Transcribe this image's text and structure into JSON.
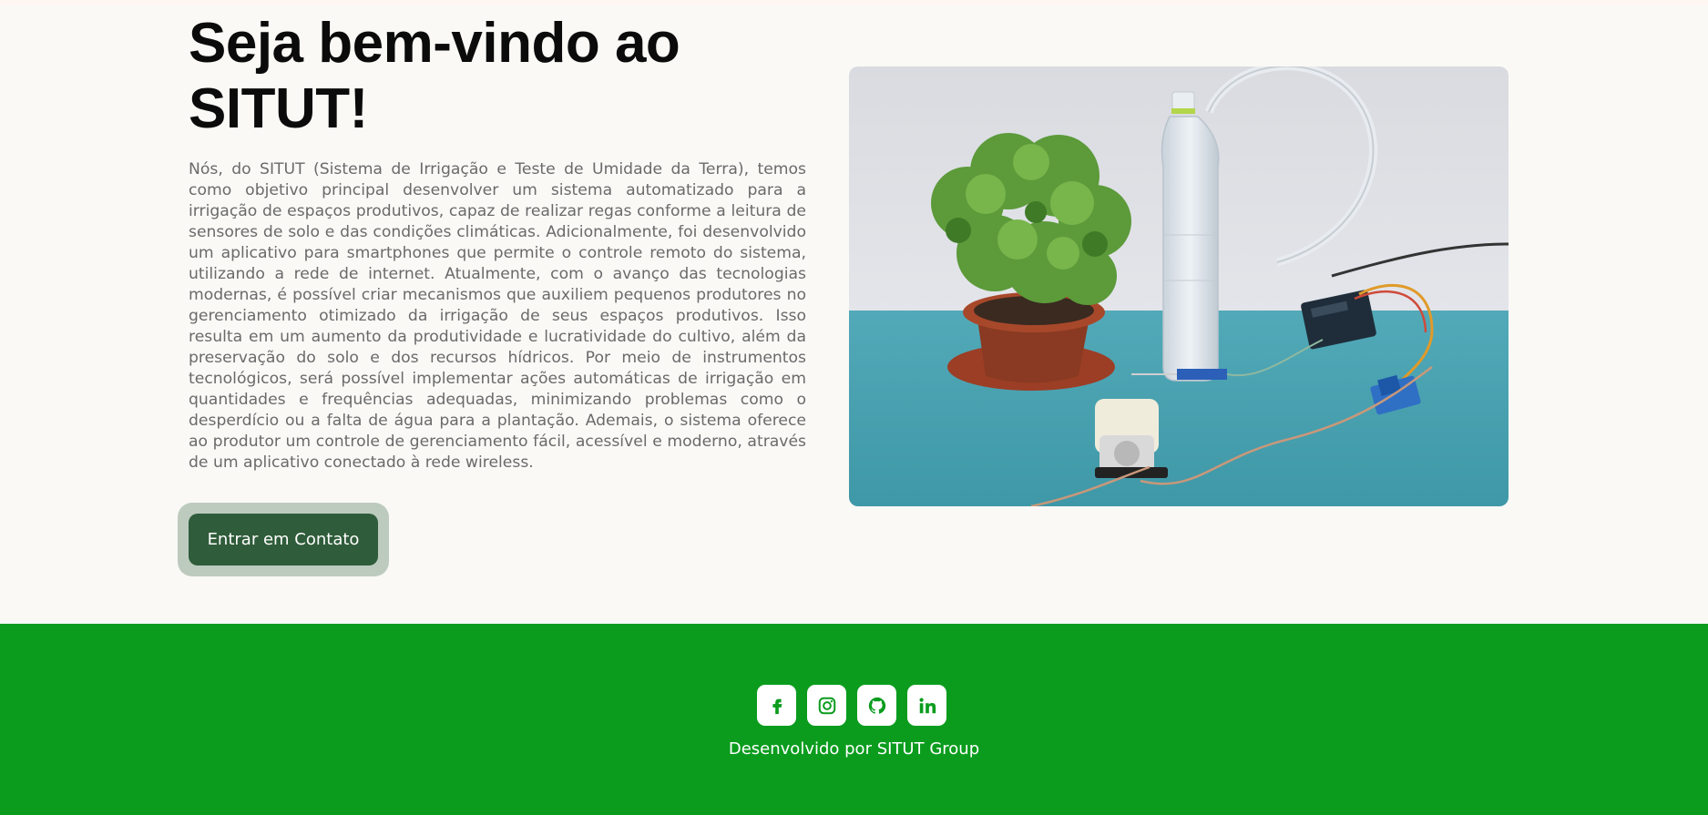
{
  "hero": {
    "title": "Seja bem-vindo ao SITUT!",
    "description": "Nós, do SITUT (Sistema de Irrigação e Teste de Umidade da Terra), temos como objetivo principal desenvolver um sistema automatizado para a irrigação de espaços produtivos, capaz de realizar regas conforme a leitura de sensores de solo e das condições climáticas. Adicionalmente, foi desenvolvido um aplicativo para smartphones que permite o controle remoto do sistema, utilizando a rede de internet. Atualmente, com o avanço das tecnologias modernas, é possível criar mecanismos que auxiliem pequenos produtores no gerenciamento otimizado da irrigação de seus espaços produtivos. Isso resulta em um aumento da produtividade e lucratividade do cultivo, além da preservação do solo e dos recursos hídricos. Por meio de instrumentos tecnológicos, será possível implementar ações automáticas de irrigação em quantidades e frequências adequadas, minimizando problemas como o desperdício ou a falta de água para a plantação. Ademais, o sistema oferece ao produtor um controle de gerenciamento fácil, acessível e moderno, através de um aplicativo conectado à rede wireless.",
    "button_label": "Entrar em Contato"
  },
  "footer": {
    "credit": "Desenvolvido por SITUT Group",
    "socials": [
      {
        "icon": "facebook-icon"
      },
      {
        "icon": "instagram-icon"
      },
      {
        "icon": "github-icon"
      },
      {
        "icon": "linkedin-icon"
      }
    ]
  },
  "colors": {
    "background": "#faf9f6",
    "button": "#2f5c3a",
    "button_halo": "#bdcbbf",
    "footer": "#0b9c1e",
    "social_icon": "#0b9c1e"
  }
}
